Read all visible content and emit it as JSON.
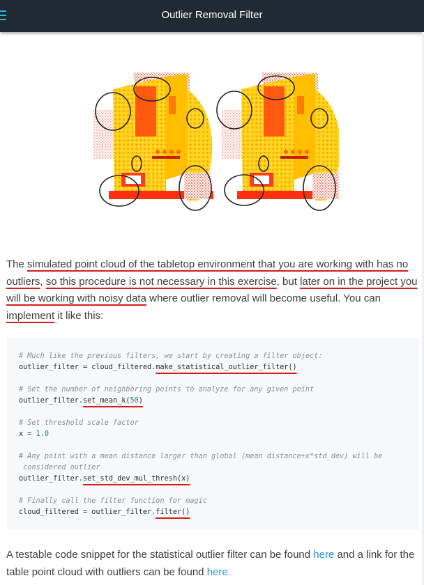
{
  "header": {
    "title": "Outlier Removal Filter"
  },
  "intro": {
    "s1": "The ",
    "s2": "simulated point cloud of the tabletop environment that you are working with has no outliers",
    "s3": ", ",
    "s4": "so this procedure is not necessary in this exercise",
    "s5": ", but ",
    "s6": "later on in the project you will be working with noisy data",
    "s7": " where outlier removal will become useful. You can ",
    "s8": "implement",
    "s9": " it like this:"
  },
  "code": {
    "c1": "# Much like the previous filters, we start by creating a filter object:",
    "l1a": "outlier_filter = cloud_filtered.",
    "l1b": "make_statistical_outlier_filter()",
    "c2": "# Set the number of neighboring points to analyze for any given point",
    "l2a": "outlier_filter.",
    "l2b": "set_mean_k(",
    "l2c": "50",
    "l2d": ")",
    "c3": "# Set threshold scale factor",
    "l3a": "x = ",
    "l3b": "1.0",
    "c4a": "# Any point with a mean distance larger than global (mean distance+x*std_dev) will be",
    "c4b": "considered outlier",
    "l4a": "outlier_filter.",
    "l4b": "set_std_dev_mul_thresh(x)",
    "c5": "# Finally call the filter function for magic",
    "l5a": "cloud_filtered = outlier_filter.",
    "l5b": "filter()"
  },
  "footer": {
    "t1": "A testable code snippet for the statistical outlier filter can be found ",
    "link1": "here",
    "t2": " and a link for the table point cloud with outliers can be found ",
    "link2": "here",
    "t3": "."
  },
  "colors": {
    "accent": "#1a9ad6",
    "header_bg": "#1f2a35",
    "annotation_red": "#d41c1c"
  }
}
